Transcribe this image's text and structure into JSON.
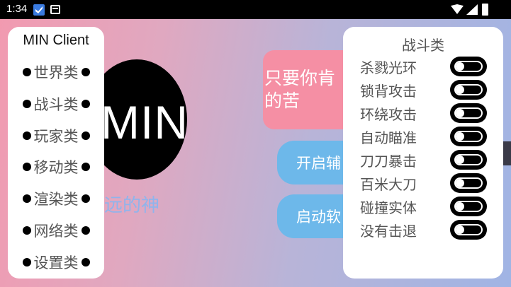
{
  "status_bar": {
    "time": "1:34",
    "icons": [
      "notification-bird-icon",
      "calendar-icon",
      "wifi-icon",
      "signal-icon",
      "battery-icon"
    ]
  },
  "background": {
    "logo_text": "MIN",
    "subtitle": "远的神",
    "pink_card_text": "只要你肯的苦",
    "button_1_label": "开启辅",
    "button_2_label": "启动软"
  },
  "left_panel": {
    "title": "MIN Client",
    "items": [
      {
        "label": "世界类"
      },
      {
        "label": "战斗类"
      },
      {
        "label": "玩家类"
      },
      {
        "label": "移动类"
      },
      {
        "label": "渲染类"
      },
      {
        "label": "网络类"
      },
      {
        "label": "设置类"
      }
    ]
  },
  "right_panel": {
    "title": "战斗类",
    "toggles": [
      {
        "label": "杀戮光环",
        "enabled": false
      },
      {
        "label": "锁背攻击",
        "enabled": false
      },
      {
        "label": "环绕攻击",
        "enabled": false
      },
      {
        "label": "自动瞄准",
        "enabled": false
      },
      {
        "label": "刀刀暴击",
        "enabled": false
      },
      {
        "label": "百米大刀",
        "enabled": false
      },
      {
        "label": "碰撞实体",
        "enabled": false
      },
      {
        "label": "没有击退",
        "enabled": false
      }
    ]
  },
  "colors": {
    "accent_blue": "#6db8ea",
    "accent_pink": "#f58fa4",
    "panel_bg": "#ffffff"
  }
}
